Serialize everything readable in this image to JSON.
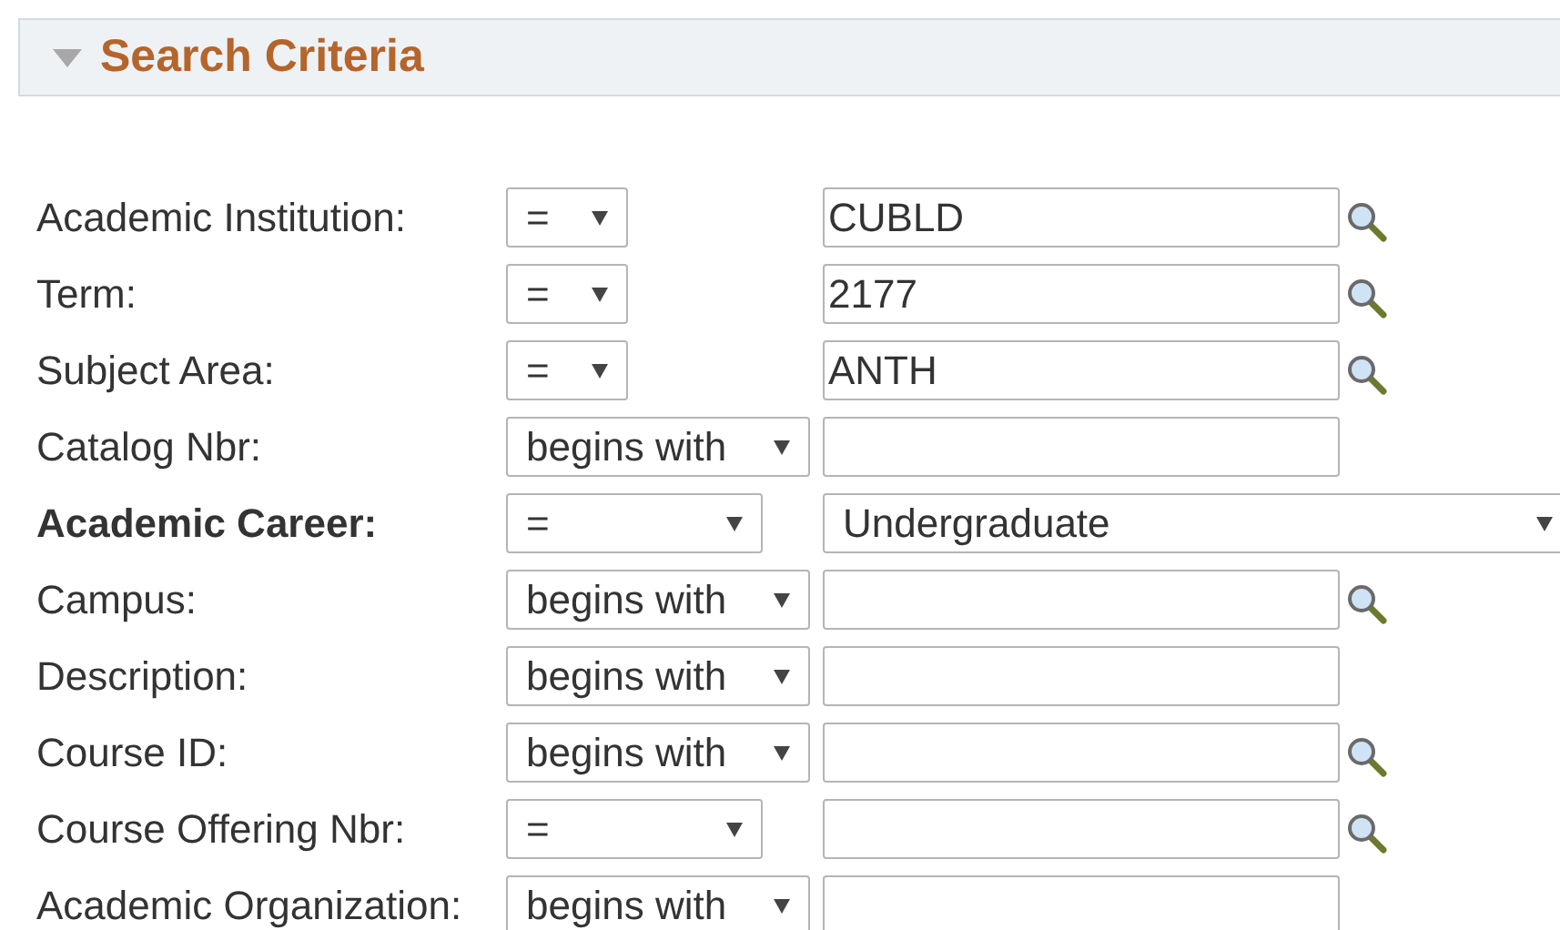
{
  "section": {
    "title": "Search Criteria",
    "expanded": true
  },
  "fields": [
    {
      "label": "Academic Institution:",
      "bold": false,
      "operator": {
        "value": "=",
        "kind": "short"
      },
      "value": {
        "kind": "text",
        "text": "CUBLD"
      },
      "lookup": true
    },
    {
      "label": "Term:",
      "bold": false,
      "operator": {
        "value": "=",
        "kind": "short"
      },
      "value": {
        "kind": "text",
        "text": "2177"
      },
      "lookup": true
    },
    {
      "label": "Subject Area:",
      "bold": false,
      "operator": {
        "value": "=",
        "kind": "short"
      },
      "value": {
        "kind": "text",
        "text": "ANTH"
      },
      "lookup": true
    },
    {
      "label": "Catalog Nbr:",
      "bold": false,
      "operator": {
        "value": "begins with",
        "kind": "long"
      },
      "value": {
        "kind": "text"
      },
      "lookup": false
    },
    {
      "label": "Academic Career:",
      "bold": true,
      "operator": {
        "value": "=",
        "kind": "medium"
      },
      "value": {
        "kind": "select",
        "text": "Undergraduate"
      },
      "lookup": false
    },
    {
      "label": "Campus:",
      "bold": false,
      "operator": {
        "value": "begins with",
        "kind": "long"
      },
      "value": {
        "kind": "text"
      },
      "lookup": true
    },
    {
      "label": "Description:",
      "bold": false,
      "operator": {
        "value": "begins with",
        "kind": "long"
      },
      "value": {
        "kind": "text"
      },
      "lookup": false
    },
    {
      "label": "Course ID:",
      "bold": false,
      "operator": {
        "value": "begins with",
        "kind": "long"
      },
      "value": {
        "kind": "text"
      },
      "lookup": true
    },
    {
      "label": "Course Offering Nbr:",
      "bold": false,
      "operator": {
        "value": "=",
        "kind": "medium"
      },
      "value": {
        "kind": "text"
      },
      "lookup": true
    },
    {
      "label": "Academic Organization:",
      "bold": false,
      "operator": {
        "value": "begins with",
        "kind": "long"
      },
      "value": {
        "kind": "text"
      },
      "lookup": false
    }
  ]
}
